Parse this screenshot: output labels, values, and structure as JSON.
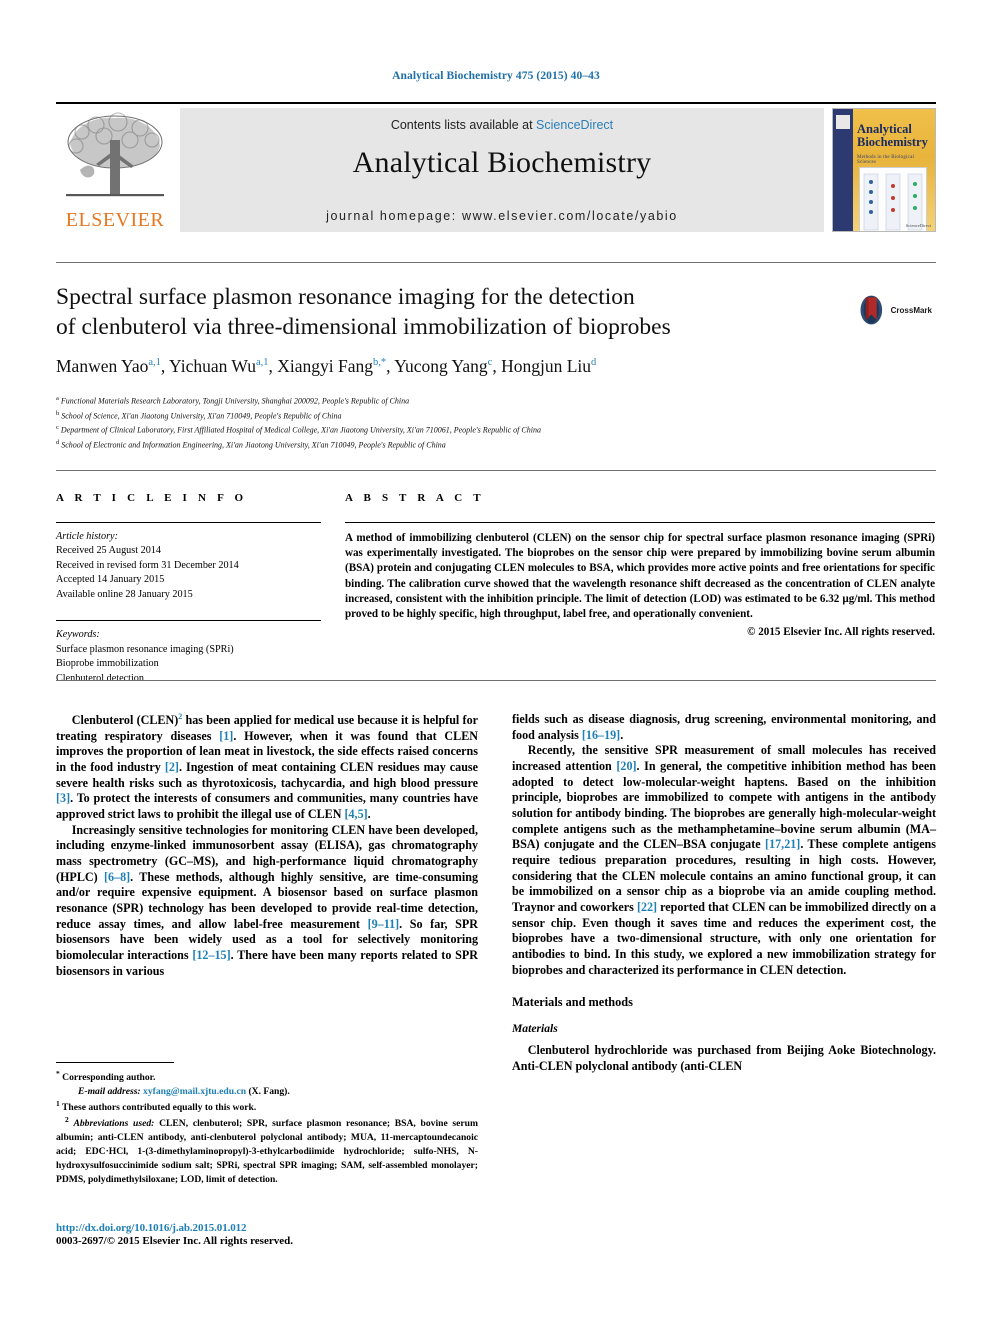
{
  "running_head": "Analytical Biochemistry 475 (2015) 40–43",
  "colors": {
    "link": "#1e7fb5",
    "running_head": "#1e6fa8",
    "elsevier_orange": "#e87722",
    "sciencedirect_blue": "#2a7fb8",
    "panel_gray": "#e6e6e6"
  },
  "masthead": {
    "publisher_name": "ELSEVIER",
    "contents_prefix": "Contents lists available at",
    "contents_link": "ScienceDirect",
    "journal_name": "Analytical Biochemistry",
    "homepage": "journal homepage: www.elsevier.com/locate/yabio",
    "cover": {
      "title_line1": "Analytical",
      "title_line2": "Biochemistry",
      "subtitle": "Methods in the Biological Sciences",
      "footer": "ScienceDirect"
    }
  },
  "article": {
    "title_line1": "Spectral surface plasmon resonance imaging for the detection",
    "title_line2": "of clenbuterol via three-dimensional immobilization of bioprobes",
    "crossmark_label": "CrossMark",
    "authors": [
      {
        "name": "Manwen Yao",
        "marks": "a,1",
        "sep": ", "
      },
      {
        "name": "Yichuan Wu",
        "marks": "a,1",
        "sep": ", "
      },
      {
        "name": "Xiangyi Fang",
        "marks": "b,*",
        "sep": ", "
      },
      {
        "name": "Yucong Yang",
        "marks": "c",
        "sep": ", "
      },
      {
        "name": "Hongjun Liu",
        "marks": "d",
        "sep": ""
      }
    ],
    "affiliations": [
      {
        "mark": "a",
        "text": "Functional Materials Research Laboratory, Tongji University, Shanghai 200092, People's Republic of China"
      },
      {
        "mark": "b",
        "text": "School of Science, Xi'an Jiaotong University, Xi'an 710049, People's Republic of China"
      },
      {
        "mark": "c",
        "text": "Department of Clinical Laboratory, First Affiliated Hospital of Medical College, Xi'an Jiaotong University, Xi'an 710061, People's Republic of China"
      },
      {
        "mark": "d",
        "text": "School of Electronic and Information Engineering, Xi'an Jiaotong University, Xi'an 710049, People's Republic of China"
      }
    ]
  },
  "article_info": {
    "heading": "A R T I C L E    I N F O",
    "history_label": "Article history:",
    "history": [
      "Received 25 August 2014",
      "Received in revised form 31 December 2014",
      "Accepted 14 January 2015",
      "Available online 28 January 2015"
    ],
    "keywords_label": "Keywords:",
    "keywords": [
      "Surface plasmon resonance imaging (SPRi)",
      "Bioprobe immobilization",
      "Clenbuterol detection"
    ]
  },
  "abstract": {
    "heading": "A B S T R A C T",
    "text": "A method of immobilizing clenbuterol (CLEN) on the sensor chip for spectral surface plasmon resonance imaging (SPRi) was experimentally investigated. The bioprobes on the sensor chip were prepared by immobilizing bovine serum albumin (BSA) protein and conjugating CLEN molecules to BSA, which provides more active points and free orientations for specific binding. The calibration curve showed that the wavelength resonance shift decreased as the concentration of CLEN analyte increased, consistent with the inhibition principle. The limit of detection (LOD) was estimated to be 6.32 µg/ml. This method proved to be highly specific, high throughput, label free, and operationally convenient.",
    "copyright": "© 2015 Elsevier Inc. All rights reserved."
  },
  "body": {
    "left": [
      {
        "id": "p1",
        "parts": [
          {
            "t": "Clenbuterol (CLEN)"
          },
          {
            "t": "2",
            "sup": true
          },
          {
            "t": " has been applied for medical use because it is helpful for treating respiratory diseases "
          },
          {
            "t": "[1]",
            "ref": true
          },
          {
            "t": ". However, when it was found that CLEN improves the proportion of lean meat in livestock, the side effects raised concerns in the food industry "
          },
          {
            "t": "[2]",
            "ref": true
          },
          {
            "t": ". Ingestion of meat containing CLEN residues may cause severe health risks such as thyrotoxicosis, tachycardia, and high blood pressure "
          },
          {
            "t": "[3]",
            "ref": true
          },
          {
            "t": ". To protect the interests of consumers and communities, many countries have approved strict laws to prohibit the illegal use of CLEN "
          },
          {
            "t": "[4,5]",
            "ref": true
          },
          {
            "t": "."
          }
        ]
      },
      {
        "id": "p2",
        "parts": [
          {
            "t": "Increasingly sensitive technologies for monitoring CLEN have been developed, including enzyme-linked immunosorbent assay (ELISA), gas chromatography mass spectrometry (GC–MS), and high-performance liquid chromatography (HPLC) "
          },
          {
            "t": "[6–8]",
            "ref": true
          },
          {
            "t": ". These methods, although highly sensitive, are time-consuming and/or require expensive equipment. A biosensor based on surface plasmon resonance (SPR) technology has been developed to provide real-time detection, reduce assay times, and allow label-free measurement "
          },
          {
            "t": "[9–11]",
            "ref": true
          },
          {
            "t": ". So far, SPR biosensors have been widely used as a tool for selectively monitoring biomolecular interactions "
          },
          {
            "t": "[12–15]",
            "ref": true
          },
          {
            "t": ". There have been many reports related to SPR biosensors in various"
          }
        ]
      }
    ],
    "right": [
      {
        "id": "p3",
        "indent": false,
        "parts": [
          {
            "t": "fields such as disease diagnosis, drug screening, environmental monitoring, and food analysis "
          },
          {
            "t": "[16–19]",
            "ref": true
          },
          {
            "t": "."
          }
        ]
      },
      {
        "id": "p4",
        "indent": true,
        "parts": [
          {
            "t": "Recently, the sensitive SPR measurement of small molecules has received increased attention "
          },
          {
            "t": "[20]",
            "ref": true
          },
          {
            "t": ". In general, the competitive inhibition method has been adopted to detect low-molecular-weight haptens. Based on the inhibition principle, bioprobes are immobilized to compete with antigens in the antibody solution for antibody binding. The bioprobes are generally high-molecular-weight complete antigens such as the methamphetamine–bovine serum albumin (MA–BSA) conjugate and the CLEN–BSA conjugate "
          },
          {
            "t": "[17,21]",
            "ref": true
          },
          {
            "t": ". These complete antigens require tedious preparation procedures, resulting in high costs. However, considering that the CLEN molecule contains an amino functional group, it can be immobilized on a sensor chip as a bioprobe via an amide coupling method. Traynor and coworkers "
          },
          {
            "t": "[22]",
            "ref": true
          },
          {
            "t": " reported that CLEN can be immobilized directly on a sensor chip. Even though it saves time and reduces the experiment cost, the bioprobes have a two-dimensional structure, with only one orientation for antibodies to bind. In this study, we explored a new immobilization strategy for bioprobes and characterized its performance in CLEN detection."
          }
        ]
      }
    ],
    "headings": {
      "materials_and_methods": "Materials and methods",
      "materials": "Materials"
    },
    "materials_paragraph": "Clenbuterol hydrochloride was purchased from Beijing Aoke Biotechnology. Anti-CLEN polyclonal antibody (anti-CLEN"
  },
  "footnotes": {
    "corresponding": "Corresponding author.",
    "email_label": "E-mail address:",
    "email": "xyfang@mail.xjtu.edu.cn",
    "email_suffix": "(X. Fang).",
    "note1_marker": "1",
    "note1": "These authors contributed equally to this work.",
    "note2_marker": "2",
    "note2_label": "Abbreviations used:",
    "note2": " CLEN, clenbuterol; SPR, surface plasmon resonance; BSA, bovine serum albumin; anti-CLEN antibody, anti-clenbuterol polyclonal antibody; MUA, 11-mercaptoundecanoic acid; EDC·HCl, 1-(3-dimethylaminopropyl)-3-ethylcarbodiimide hydrochloride; sulfo-NHS, N-hydroxysulfosuccinimide sodium salt; SPRi, spectral SPR imaging; SAM, self-assembled monolayer; PDMS, polydimethylsiloxane; LOD, limit of detection."
  },
  "doi": {
    "url": "http://dx.doi.org/10.1016/j.ab.2015.01.012",
    "issn_line": "0003-2697/© 2015 Elsevier Inc. All rights reserved."
  }
}
